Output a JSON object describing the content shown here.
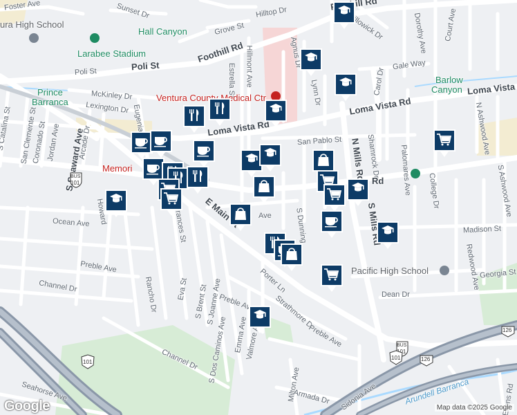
{
  "map": {
    "attribution": "Map data ©2025 Google",
    "logo": "Google",
    "colors": {
      "background": "#eef0f3",
      "road": "#ffffff",
      "highway": "#8a97a8",
      "park": "#cfe9cf",
      "hospital": "#f6d6d6",
      "water": "#aadaff",
      "marker": "#0d3b66"
    }
  },
  "labels": {
    "streets": {
      "foster_ave": "Foster Ave",
      "sunset_dr": "Sunset Dr",
      "hilltop_dr": "Hilltop Dr",
      "foothill_rd_top": "Foothill Rd",
      "willowick_dr": "Willowick Dr",
      "dorothy_ave": "Dorothy Ave",
      "court_ave": "Court Ave",
      "grove_st": "Grove St",
      "foothill_rd_mid": "Foothill Rd",
      "poli_st": "Poli St",
      "hillmont_ave": "Hillmont Ave",
      "estrella_st": "Estrella St",
      "agnus_dr": "Agnus Dr",
      "gale_way": "Gale Way",
      "lynn_dr": "Lynn Dr",
      "carol_dr": "Carol Dr",
      "mckinley_dr": "McKinley Dr",
      "loma_vista_rd_e": "Loma Vista Rd",
      "loma_vista_rd_mid": "Loma Vista Rd",
      "loma_vista_rd_w": "Loma Vista Rd",
      "lexington_dr": "Lexington Dr",
      "eugenia": "Eugenia",
      "san_pablo_st": "San Pablo St",
      "n_mills_rd": "N Mills Rd",
      "shamrock_dr": "Shamrock Dr",
      "palomares_ave": "Palomares Ave",
      "n_ashwood_ave": "N Ashwood Ave",
      "s_ashwood_ave": "S Ashwood Ave",
      "s_catalina_st": "S Catalina St",
      "san_clemente_st": "San Clemente St",
      "coronado_st": "Coronado St",
      "jordan_ave": "Jordan Ave",
      "s_seaward_ave": "S Seaward Ave",
      "arcade_dr": "Arcade Dr",
      "howard": "Howard",
      "ocean_ave": "Ocean Ave",
      "ave_short": "Ave",
      "frances_st": "Frances St",
      "e_main_st": "E Main St",
      "s_dunning": "S Dunning",
      "s_mills_rd": "S Mills Rd",
      "rd_short": "Rd",
      "college_dr": "College Dr",
      "madison_st": "Madison St",
      "redwood_ave": "Redwood Ave",
      "georgia_st": "Georgia St",
      "dean_dr": "Dean Dr",
      "preble_ave_w": "Preble Ave",
      "channel_dr_w": "Channel Dr",
      "rancho_dr": "Rancho Dr",
      "eva_st": "Eva St",
      "s_brent_st": "S Brent St",
      "s_joanne_ave": "S Joanne Ave",
      "porter_ln": "Porter Ln",
      "preble_ave_mid": "Preble Ave",
      "strathmore_dr": "Strathmore Dr",
      "emma_ave": "Emma Ave",
      "valmore_ave": "Valmore Ave",
      "s_dos_caminos_ave": "S Dos Caminos Ave",
      "preble_ave_e": "Preble Ave",
      "channel_dr_s": "Channel Dr",
      "milton_ave": "Milton Ave",
      "armada_dr": "Armada Dr",
      "sidonia_ave": "Sidonia Ave",
      "seahorse_ave": "Seahorse Ave",
      "arundell_barranca": "Arundell Barranca",
      "ellens_rd": "Ellens Rd"
    },
    "places": {
      "high_school_nw": "ura High School",
      "hall_canyon": "Hall Canyon",
      "larabee_stadium": "Larabee Stadium",
      "prince_barranca_1": "Prince",
      "prince_barranca_2": "Barranca",
      "barlow_canyon_1": "Barlow",
      "barlow_canyon_2": "Canyon",
      "medical_ctr": "Ventura County Medical Ctr",
      "memorial": "Memori",
      "pacific_high": "Pacific High School"
    },
    "shields": {
      "bus_101_w": "101",
      "bus_101_e": "101",
      "us_101_sw": "101",
      "us_101_e": "101",
      "ca_126_a": "126",
      "ca_126_b": "126",
      "bus_label": "BUS"
    }
  },
  "markers": [
    {
      "type": "school",
      "icon": "graduation-cap-icon"
    },
    {
      "type": "school",
      "icon": "graduation-cap-icon"
    },
    {
      "type": "school",
      "icon": "graduation-cap-icon"
    },
    {
      "type": "restaurant",
      "icon": "fork-knife-icon"
    },
    {
      "type": "restaurant",
      "icon": "fork-knife-icon"
    },
    {
      "type": "school",
      "icon": "graduation-cap-icon"
    },
    {
      "type": "grocery",
      "icon": "shopping-cart-icon"
    },
    {
      "type": "cafe",
      "icon": "coffee-cup-icon"
    },
    {
      "type": "cafe",
      "icon": "coffee-cup-icon"
    },
    {
      "type": "cafe",
      "icon": "coffee-cup-icon"
    },
    {
      "type": "school",
      "icon": "graduation-cap-icon"
    },
    {
      "type": "school",
      "icon": "graduation-cap-icon"
    },
    {
      "type": "shopping",
      "icon": "shopping-bag-icon"
    },
    {
      "type": "grocery",
      "icon": "shopping-cart-icon"
    },
    {
      "type": "cafe",
      "icon": "coffee-cup-icon"
    },
    {
      "type": "restaurant",
      "icon": "fork-knife-icon"
    },
    {
      "type": "restaurant",
      "icon": "fork-knife-icon"
    },
    {
      "type": "restaurant",
      "icon": "fork-knife-icon"
    },
    {
      "type": "grocery",
      "icon": "shopping-cart-icon"
    },
    {
      "type": "grocery",
      "icon": "shopping-cart-icon"
    },
    {
      "type": "shopping",
      "icon": "shopping-bag-icon"
    },
    {
      "type": "school",
      "icon": "graduation-cap-icon"
    },
    {
      "type": "grocery",
      "icon": "shopping-cart-icon"
    },
    {
      "type": "school",
      "icon": "graduation-cap-icon"
    },
    {
      "type": "shopping",
      "icon": "shopping-bag-icon"
    },
    {
      "type": "cafe",
      "icon": "coffee-cup-icon"
    },
    {
      "type": "school",
      "icon": "graduation-cap-icon"
    },
    {
      "type": "restaurant",
      "icon": "fork-knife-icon"
    },
    {
      "type": "cafe",
      "icon": "coffee-cup-icon"
    },
    {
      "type": "shopping",
      "icon": "shopping-bag-icon"
    },
    {
      "type": "grocery",
      "icon": "shopping-cart-icon"
    },
    {
      "type": "school",
      "icon": "graduation-cap-icon"
    }
  ]
}
